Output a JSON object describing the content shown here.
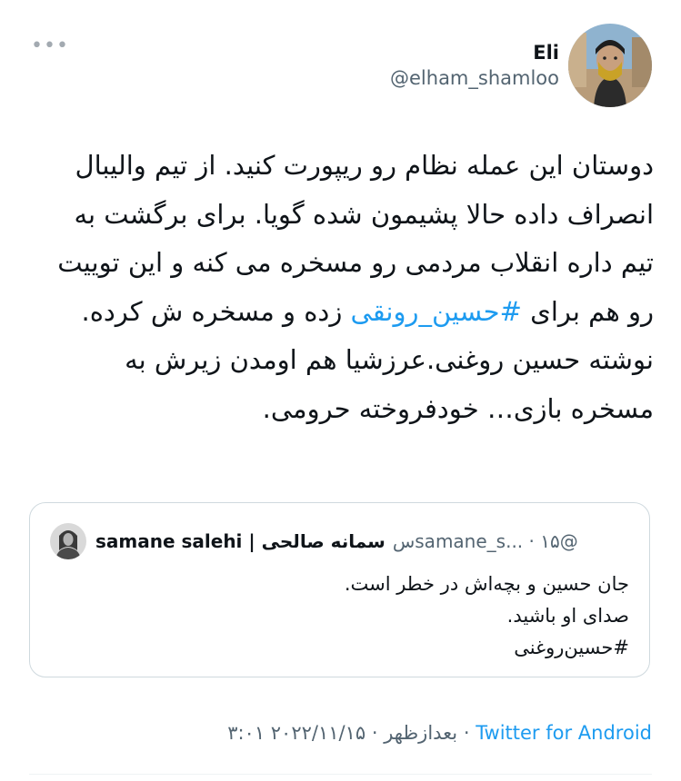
{
  "tweet": {
    "author": {
      "display_name": "Eli",
      "handle": "@elham_shamloo"
    },
    "more_label": "•••",
    "text_before": "دوستان این عمله نظام رو ریپورت کنید. از تیم والیبال انصراف داده حالا پشیمون شده گویا. برای برگشت به تیم داره انقلاب مردمی رو مسخره می کنه و این توییت رو هم برای ",
    "hashtag": "#حسین_رونقی",
    "text_after": " زده و مسخره ش کرده. نوشته حسین روغنی.عرزشیا هم اومدن زیرش به مسخره بازی… خودفروخته حرومی."
  },
  "quoted": {
    "name": "samane salehi | سمانه صالحی",
    "meta": "@samane_s... · ۱۵س",
    "lines": [
      "جان حسین و بچه‌اش در خطر است.",
      "صدای او باشید.",
      "#حسین‌روغنی"
    ]
  },
  "footer": {
    "timestamp": "۳:۰۱ بعدازظهر · ۲۰۲۲/۱۱/۱۵ · ",
    "source": "Twitter for Android"
  }
}
